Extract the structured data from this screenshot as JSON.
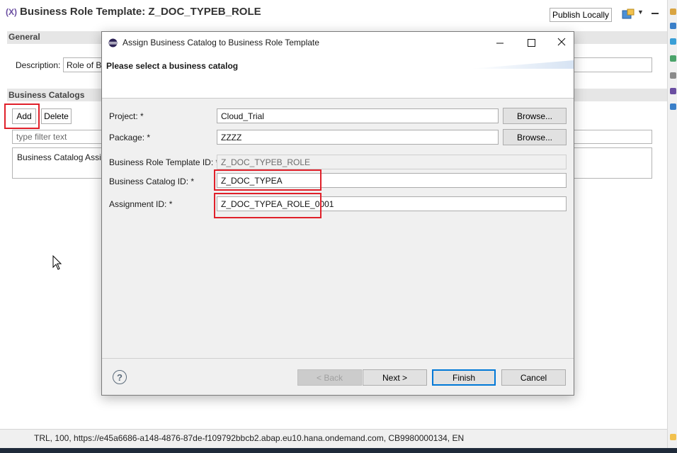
{
  "editor": {
    "title_icon": "(X)",
    "title": "Business Role Template: Z_DOC_TYPEB_ROLE",
    "publish_label": "Publish Locally",
    "general_section": "General",
    "description_label": "Description:",
    "description_value": "Role of B",
    "business_catalogs_section": "Business Catalogs",
    "add_label": "Add",
    "delete_label": "Delete",
    "filter_placeholder": "type filter text",
    "catalog_row_text": "Business Catalog Assig"
  },
  "dialog": {
    "title": "Assign Business Catalog to Business Role Template",
    "heading": "Please select a business catalog",
    "fields": {
      "project_label": "Project: *",
      "project_value": "Cloud_Trial",
      "package_label": "Package: *",
      "package_value": "ZZZZ",
      "brt_label": "Business Role Template ID: *",
      "brt_value": "Z_DOC_TYPEB_ROLE",
      "bcid_label": "Business Catalog ID: *",
      "bcid_value": "Z_DOC_TYPEA",
      "assign_label": "Assignment ID: *",
      "assign_value": "Z_DOC_TYPEA_ROLE_0001"
    },
    "browse_label": "Browse...",
    "buttons": {
      "back": "< Back",
      "next": "Next >",
      "finish": "Finish",
      "cancel": "Cancel"
    },
    "help_glyph": "?"
  },
  "status_bar": {
    "text": "TRL, 100, https://e45a6686-a148-4876-87de-f109792bbcb2.abap.eu10.hana.ondemand.com, CB9980000134, EN"
  },
  "colors": {
    "highlight": "#e0202a",
    "finish_border": "#0078d7",
    "section_bar": "#e6e6e6"
  },
  "icons": {
    "editor": "role-template-icon",
    "dialog": "eclipse-icon",
    "help": "help-icon",
    "cursor": "mouse-pointer-icon"
  }
}
